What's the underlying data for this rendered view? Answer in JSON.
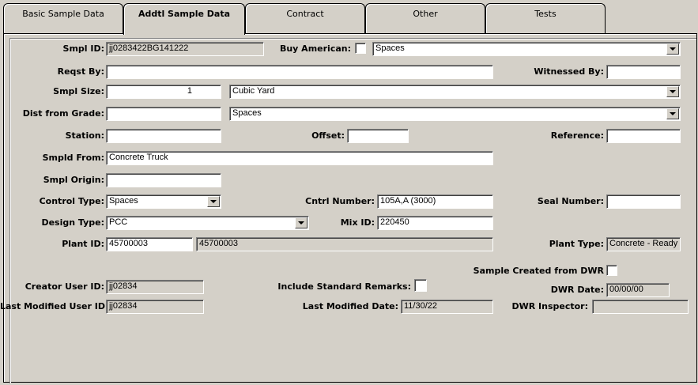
{
  "tabs": [
    {
      "label": "Basic Sample Data"
    },
    {
      "label": "Addtl Sample Data"
    },
    {
      "label": "Contract"
    },
    {
      "label": "Other"
    },
    {
      "label": "Tests"
    }
  ],
  "fields": {
    "smpl_id": {
      "label": "Smpl ID:",
      "value": "jj0283422BG141222"
    },
    "buy_american": {
      "label": "Buy American:",
      "select": "Spaces"
    },
    "reqst_by": {
      "label": "Reqst By:",
      "value": ""
    },
    "witnessed_by": {
      "label": "Witnessed By:",
      "value": ""
    },
    "smpl_size": {
      "label": "Smpl Size:",
      "value": "1",
      "unit": "Cubic Yard"
    },
    "dist_from_grade": {
      "label": "Dist from Grade:",
      "value": "",
      "select": "Spaces"
    },
    "station": {
      "label": "Station:",
      "value": ""
    },
    "offset": {
      "label": "Offset:",
      "value": ""
    },
    "reference": {
      "label": "Reference:",
      "value": ""
    },
    "smpld_from": {
      "label": "Smpld From:",
      "value": "Concrete Truck"
    },
    "smpl_origin": {
      "label": "Smpl Origin:",
      "value": ""
    },
    "control_type": {
      "label": "Control Type:",
      "select": "Spaces"
    },
    "cntrl_number": {
      "label": "Cntrl Number:",
      "value": "105A,A (3000)"
    },
    "seal_number": {
      "label": "Seal Number:",
      "value": ""
    },
    "design_type": {
      "label": "Design Type:",
      "select": "PCC"
    },
    "mix_id": {
      "label": "Mix ID:",
      "value": "220450"
    },
    "plant_id": {
      "label": "Plant ID:",
      "value": "45700003",
      "name": "45700003"
    },
    "plant_type": {
      "label": "Plant Type:",
      "value": "Concrete - Ready Mix"
    },
    "sample_created_from_dwr": {
      "label": "Sample Created from DWR"
    },
    "creator_user_id": {
      "label": "Creator User ID:",
      "value": "jj02834"
    },
    "include_standard_remarks": {
      "label": "Include Standard Remarks:"
    },
    "dwr_date": {
      "label": "DWR Date:",
      "value": "00/00/00"
    },
    "last_modified_user_id": {
      "label": "Last Modified User ID:",
      "value": "jj02834"
    },
    "last_modified_date": {
      "label": "Last Modified Date:",
      "value": "11/30/22"
    },
    "dwr_inspector": {
      "label": "DWR Inspector:",
      "value": ""
    }
  }
}
